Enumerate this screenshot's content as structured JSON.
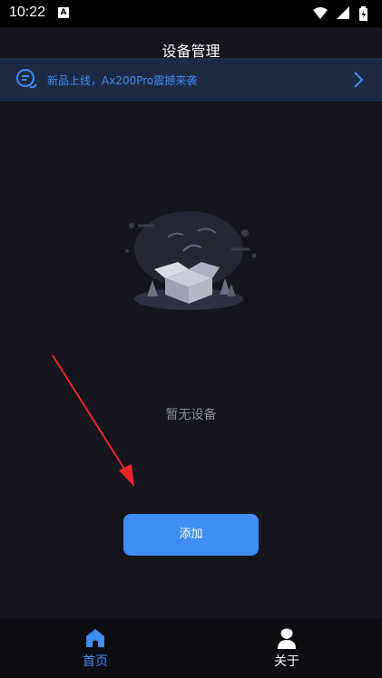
{
  "status_bar": {
    "time": "10:22",
    "badge": "A"
  },
  "header": {
    "title": "设备管理"
  },
  "banner": {
    "text": "新品上线，Ax200Pro震撼来袭",
    "icon": "chat-bubble-icon",
    "arrow_icon": "chevron-right-icon",
    "color": "#3d8bf2"
  },
  "main": {
    "empty_text": "暂无设备",
    "add_label": "添加",
    "accent": "#3e8ef3"
  },
  "bottom_nav": {
    "items": [
      {
        "label": "首页",
        "icon": "home-icon",
        "active": true
      },
      {
        "label": "关于",
        "icon": "user-icon",
        "active": false
      }
    ]
  }
}
